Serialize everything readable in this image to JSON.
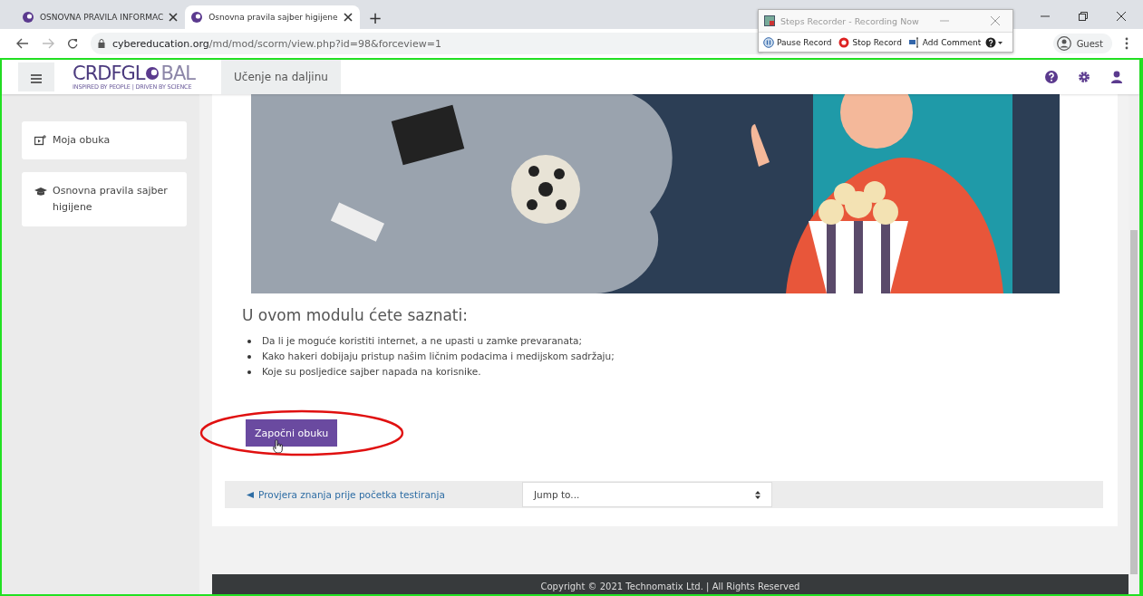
{
  "browser": {
    "tabs": [
      {
        "title": "OSNOVNA PRAVILA INFORMAC",
        "selected": false
      },
      {
        "title": "Osnovna pravila sajber higijene",
        "selected": true
      }
    ],
    "new_tab": "+",
    "url_host": "cybereducation.org",
    "url_path": "/md/mod/scorm/view.php?id=98&forceview=1",
    "profile": "Guest"
  },
  "steps_recorder": {
    "title": "Steps Recorder - Recording Now",
    "buttons": [
      {
        "label": "Pause Record",
        "kind": "pause"
      },
      {
        "label": "Stop Record",
        "kind": "stop"
      },
      {
        "label": "Add Comment",
        "kind": "comment"
      }
    ]
  },
  "navbar": {
    "logo_left": "CRDFGL",
    "logo_right": "BAL",
    "tagline": "INSPIRED BY PEOPLE | DRIVEN BY SCIENCE",
    "link": "Učenje na daljinu"
  },
  "sidebar": {
    "items": [
      {
        "label": "Moja obuka",
        "kind": "course"
      },
      {
        "label": "Osnovna pravila sajber higijene",
        "kind": "cap"
      }
    ]
  },
  "content": {
    "heading": "U ovom modulu ćete saznati:",
    "bullets": [
      "Da li je moguće koristiti internet, a ne upasti u zamke prevaranata;",
      "Kako hakeri dobijaju pristup našim ličnim podacima i medijskom sadržaju;",
      "Koje su posljedice sajber napada na korisnike."
    ],
    "start_button": "Započni obuku",
    "prev_link": "Provjera znanja prije početka testiranja",
    "jump_placeholder": "Jump to..."
  },
  "footer": {
    "text": "Copyright © 2021 Technomatix Ltd. | All Rights Reserved"
  }
}
